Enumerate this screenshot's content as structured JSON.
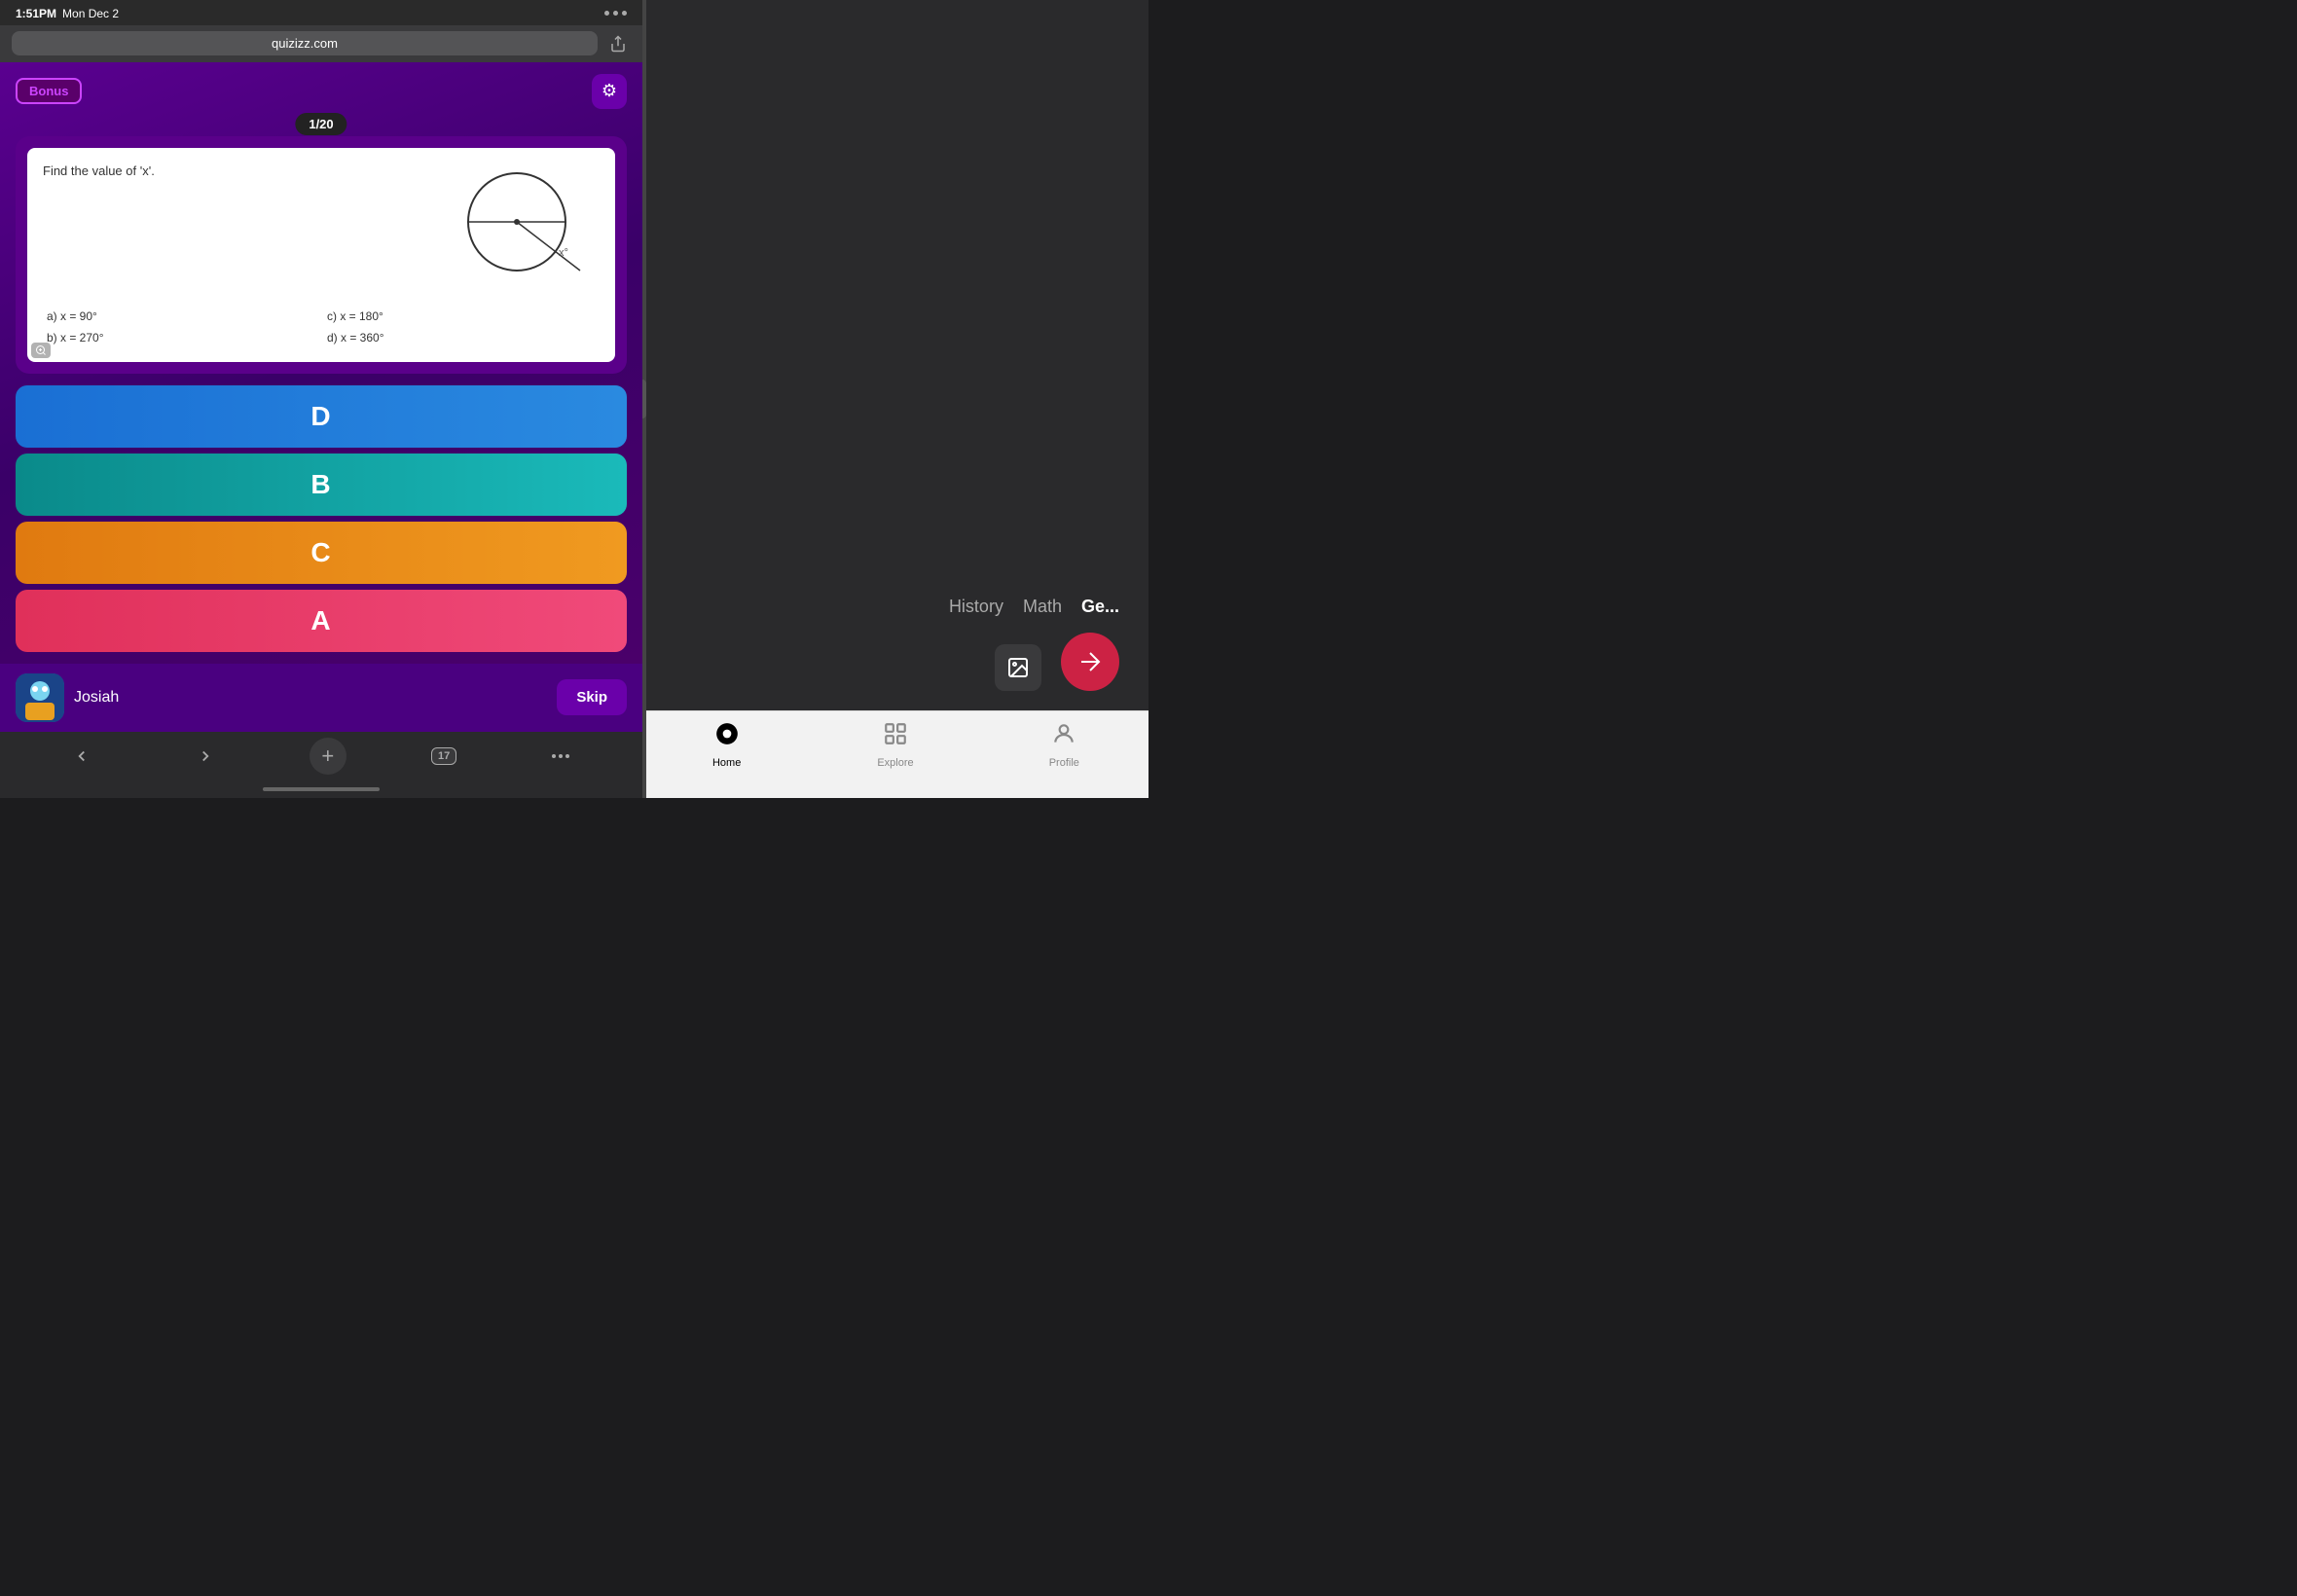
{
  "status_bar": {
    "time": "1:51PM",
    "date": "Mon Dec 2"
  },
  "browser": {
    "url": "quizizz.com"
  },
  "quiz": {
    "bonus_label": "Bonus",
    "question_counter": "1/20",
    "question_text": "Find the value of 'x'.",
    "answer_options": [
      {
        "id": "a",
        "text": "a) x = 90°"
      },
      {
        "id": "c",
        "text": "c) x = 180°"
      },
      {
        "id": "b",
        "text": "b) x = 270°"
      },
      {
        "id": "d",
        "text": "d) x = 360°"
      }
    ],
    "answer_buttons": [
      {
        "label": "D",
        "color_class": "answer-btn-d"
      },
      {
        "label": "B",
        "color_class": "answer-btn-b"
      },
      {
        "label": "C",
        "color_class": "answer-btn-c"
      },
      {
        "label": "A",
        "color_class": "answer-btn-a"
      }
    ],
    "player_name": "Josiah",
    "skip_label": "Skip"
  },
  "ios_nav": {
    "tabs_count": "17"
  },
  "right_panel": {
    "categories": [
      "History",
      "Math",
      "Ge..."
    ],
    "active_category_index": 2
  },
  "app_bar": {
    "tabs": [
      {
        "label": "Home",
        "active": true
      },
      {
        "label": "Explore",
        "active": false
      },
      {
        "label": "Profile",
        "active": false
      }
    ]
  }
}
